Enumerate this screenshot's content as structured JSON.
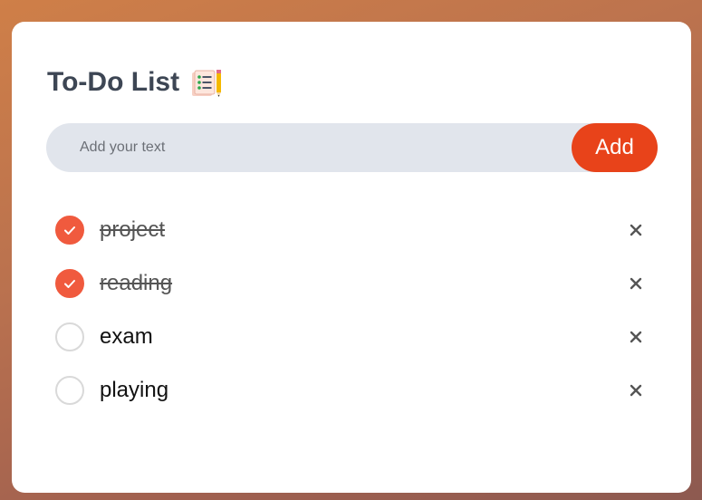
{
  "app": {
    "title": "To-Do List",
    "title_icon": "notepad-pencil-icon"
  },
  "input": {
    "value": "",
    "placeholder": "Add your text",
    "add_label": "Add"
  },
  "tasks": [
    {
      "text": "project",
      "done": true
    },
    {
      "text": "reading",
      "done": true
    },
    {
      "text": "exam",
      "done": false
    },
    {
      "text": "playing",
      "done": false
    }
  ],
  "colors": {
    "accent": "#e8431a",
    "checked": "#f05a3e",
    "title": "#3d4654",
    "input_bg": "#e1e5ec"
  }
}
